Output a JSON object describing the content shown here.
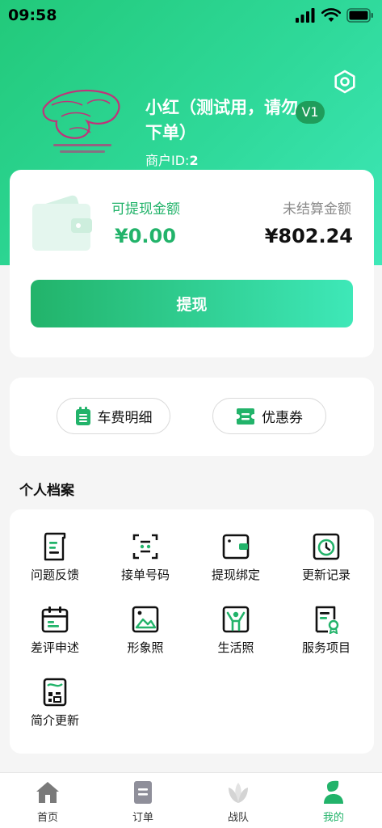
{
  "status_bar": {
    "time": "09:58"
  },
  "profile": {
    "name": "小红（测试用，请勿下单）",
    "level": "V1",
    "merchant_id_label": "商户ID:",
    "merchant_id": "2"
  },
  "wallet": {
    "available_label": "可提现金额",
    "available_value": "¥0.00",
    "unsettled_label": "未结算金额",
    "unsettled_value": "¥802.24",
    "withdraw_button": "提现"
  },
  "quick_actions": [
    {
      "label": "车费明细",
      "icon": "fare-detail-icon"
    },
    {
      "label": "优惠券",
      "icon": "coupon-icon"
    }
  ],
  "section_title": "个人档案",
  "profile_items": [
    {
      "label": "问题反馈",
      "icon": "feedback-icon"
    },
    {
      "label": "接单号码",
      "icon": "order-number-icon"
    },
    {
      "label": "提现绑定",
      "icon": "withdraw-binding-icon"
    },
    {
      "label": "更新记录",
      "icon": "update-record-icon"
    },
    {
      "label": "差评申述",
      "icon": "complaint-icon"
    },
    {
      "label": "形象照",
      "icon": "portrait-photo-icon"
    },
    {
      "label": "生活照",
      "icon": "life-photo-icon"
    },
    {
      "label": "服务项目",
      "icon": "service-items-icon"
    },
    {
      "label": "简介更新",
      "icon": "intro-update-icon"
    }
  ],
  "tabs": [
    {
      "label": "首页",
      "icon": "home-icon",
      "active": false
    },
    {
      "label": "订单",
      "icon": "orders-icon",
      "active": false
    },
    {
      "label": "战队",
      "icon": "team-icon",
      "active": false
    },
    {
      "label": "我的",
      "icon": "profile-icon",
      "active": true
    }
  ],
  "colors": {
    "brand_green": "#22b36a",
    "gradient_light": "#3ee8b8",
    "badge": "#1f9d5b"
  }
}
